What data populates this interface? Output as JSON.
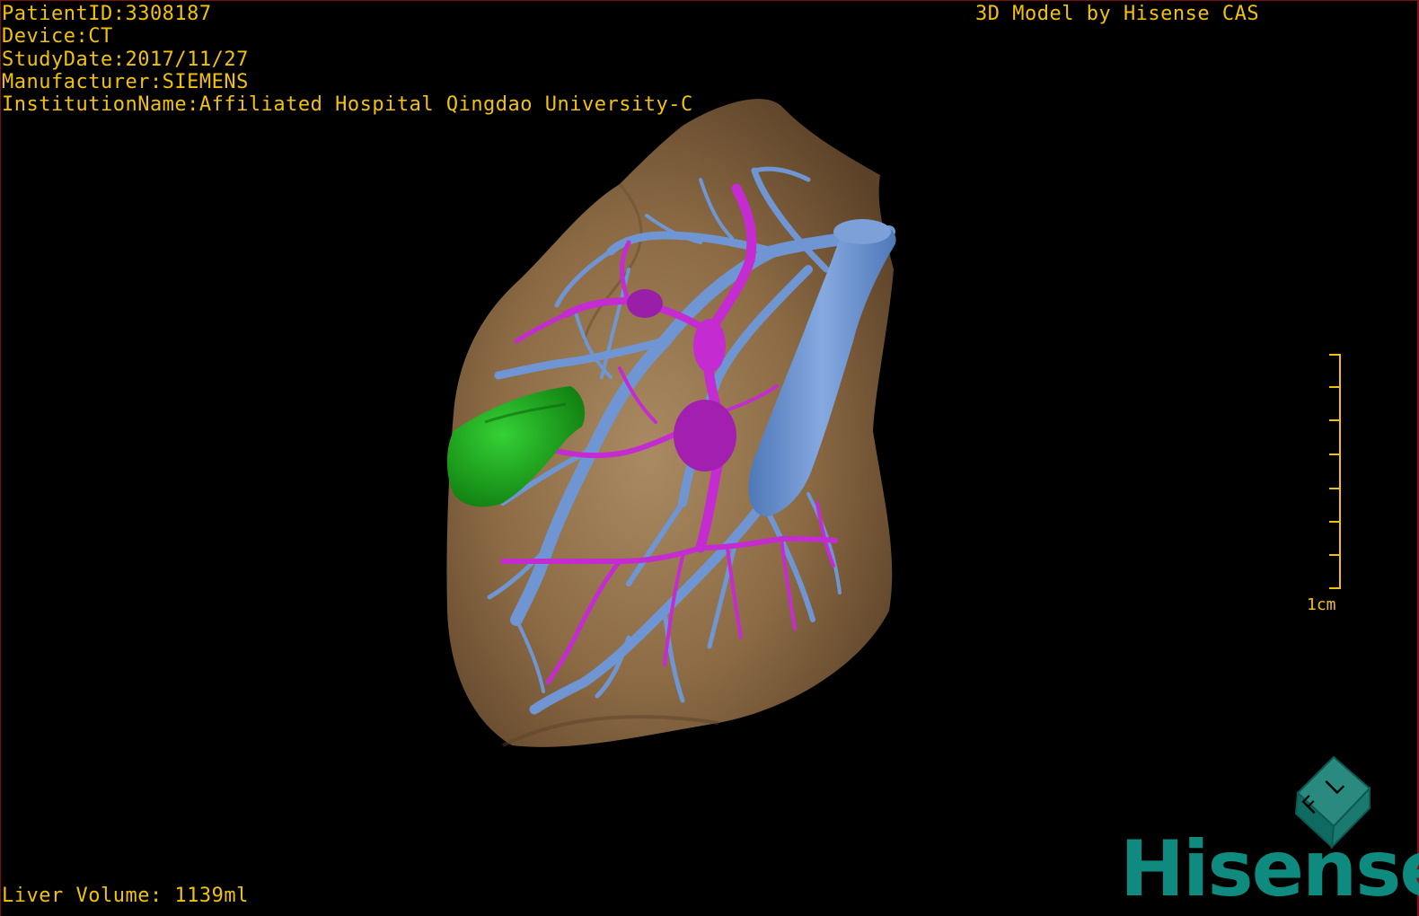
{
  "dicom_info": {
    "patient_id": "PatientID:3308187",
    "device": "Device:CT",
    "study_date": "StudyDate:2017/11/27",
    "manufacturer": "Manufacturer:SIEMENS",
    "institution": "InstitutionName:Affiliated Hospital Qingdao University-C"
  },
  "header_right": "3D Model by Hisense CAS",
  "footer": {
    "liver_volume": "Liver Volume: 1139ml"
  },
  "scale": {
    "label": "1cm"
  },
  "logo": {
    "brand": "Hisense",
    "cube_letters": [
      "F",
      "L"
    ],
    "color": "#0f8a7e"
  },
  "colors": {
    "overlay_text": "#f2c10a",
    "liver": "#8b6a44",
    "portal_vein": "#6f96d3",
    "hepatic_artery": "#c42bd0",
    "gallbladder": "#1a9a1a"
  },
  "icons": {
    "logo_cube": "cube-icon"
  }
}
